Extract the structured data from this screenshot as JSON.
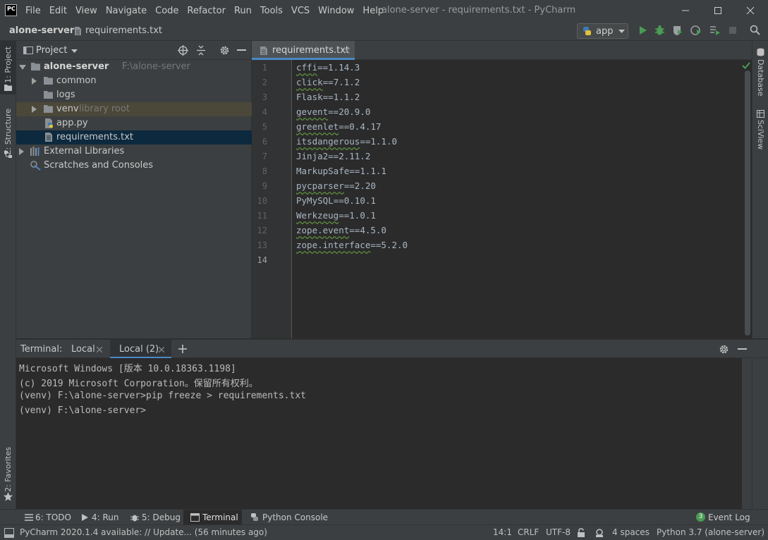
{
  "window": {
    "logo": "PC",
    "title": "alone-server - requirements.txt - PyCharm",
    "menu": [
      "File",
      "Edit",
      "View",
      "Navigate",
      "Code",
      "Refactor",
      "Run",
      "Tools",
      "VCS",
      "Window",
      "Help"
    ]
  },
  "navbar": {
    "project": "alone-server",
    "file": "requirements.txt",
    "run_config": "app"
  },
  "left_strip": {
    "project_tab": "1: Project",
    "structure_tab": "Z: Structure",
    "favorites_tab": "2: Favorites"
  },
  "right_strip": {
    "database_tab": "Database",
    "sciview_tab": "SciView"
  },
  "project_panel": {
    "title": "Project",
    "tree": {
      "root": {
        "label": "alone-server",
        "hint": "F:\\alone-server"
      },
      "common": "common",
      "logs": "logs",
      "venv": {
        "label": "venv",
        "hint": "library root"
      },
      "app": "app.py",
      "requirements": "requirements.txt",
      "external": "External Libraries",
      "scratches": "Scratches and Consoles"
    }
  },
  "editor": {
    "tab": "requirements.txt",
    "lines": [
      {
        "n": "1",
        "pkg": "cffi",
        "ver": "==1.14.3"
      },
      {
        "n": "2",
        "pkg": "click",
        "ver": "==7.1.2"
      },
      {
        "n": "3",
        "pkg": "Flask",
        "ver": "==1.1.2"
      },
      {
        "n": "4",
        "pkg": "gevent",
        "ver": "==20.9.0"
      },
      {
        "n": "5",
        "pkg": "greenlet",
        "ver": "==0.4.17"
      },
      {
        "n": "6",
        "pkg": "itsdangerous",
        "ver": "==1.1.0"
      },
      {
        "n": "7",
        "pkg": "Jinja2",
        "ver": "==2.11.2"
      },
      {
        "n": "8",
        "pkg": "MarkupSafe",
        "ver": "==1.1.1"
      },
      {
        "n": "9",
        "pkg": "pycparser",
        "ver": "==2.20"
      },
      {
        "n": "10",
        "pkg": "PyMySQL",
        "ver": "==0.10.1"
      },
      {
        "n": "11",
        "pkg": "Werkzeug",
        "ver": "==1.0.1"
      },
      {
        "n": "12",
        "pkg": "zope.event",
        "ver": "==4.5.0"
      },
      {
        "n": "13",
        "pkg": "zope.interface",
        "ver": "==5.2.0"
      },
      {
        "n": "14",
        "pkg": "",
        "ver": ""
      }
    ]
  },
  "terminal": {
    "label": "Terminal:",
    "tabs": [
      "Local",
      "Local (2)"
    ],
    "lines": [
      "Microsoft Windows [版本 10.0.18363.1198]",
      "(c) 2019 Microsoft Corporation。保留所有权利。",
      "(venv) F:\\alone-server>pip freeze > requirements.txt",
      "(venv) F:\\alone-server>"
    ]
  },
  "bottom_tools": {
    "todo": "6: TODO",
    "run": "4: Run",
    "debug": "5: Debug",
    "terminal": "Terminal",
    "python_console": "Python Console",
    "event_log": "Event Log",
    "event_count": "3"
  },
  "status": {
    "message": "PyCharm 2020.1.4 available: // Update... (56 minutes ago)",
    "position": "14:1",
    "line_sep": "CRLF",
    "encoding": "UTF-8",
    "indent": "4 spaces",
    "interpreter": "Python 3.7 (alone-server)"
  },
  "colors": {
    "accent": "#4a88c7",
    "run_green": "#499c54",
    "panel_bg": "#3c3f41",
    "editor_bg": "#2b2b2b"
  }
}
